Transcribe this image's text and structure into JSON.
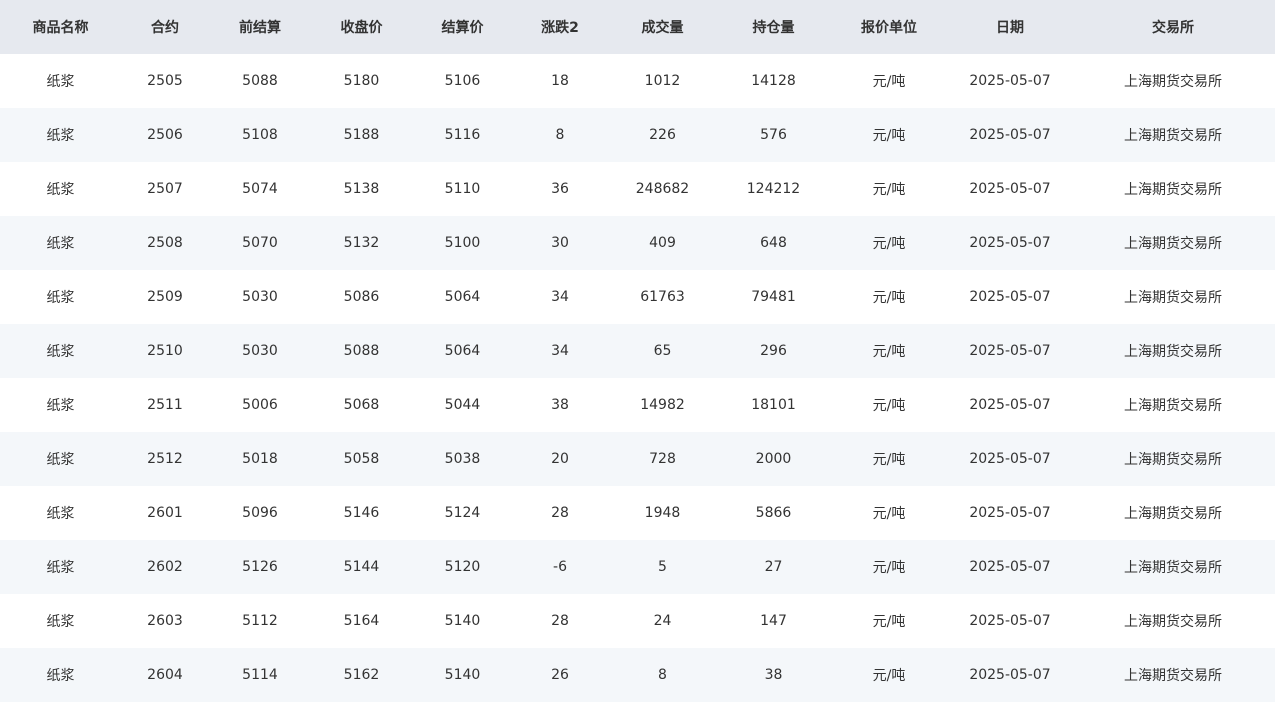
{
  "colors": {
    "up": "#e84c3d",
    "down": "#16a085",
    "header_bg": "#e6e9ef",
    "row_alt_bg": "#f4f7fa"
  },
  "table": {
    "columns": [
      "商品名称",
      "合约",
      "前结算",
      "收盘价",
      "结算价",
      "涨跌2",
      "成交量",
      "持仓量",
      "报价单位",
      "日期",
      "交易所"
    ],
    "rows": [
      {
        "name": "纸浆",
        "contract": "2505",
        "prev_settle": "5088",
        "close": "5180",
        "settle": "5106",
        "change": "18",
        "direction": "up",
        "volume": "1012",
        "open_interest": "14128",
        "unit": "元/吨",
        "date": "2025-05-07",
        "exchange": "上海期货交易所"
      },
      {
        "name": "纸浆",
        "contract": "2506",
        "prev_settle": "5108",
        "close": "5188",
        "settle": "5116",
        "change": "8",
        "direction": "up",
        "volume": "226",
        "open_interest": "576",
        "unit": "元/吨",
        "date": "2025-05-07",
        "exchange": "上海期货交易所"
      },
      {
        "name": "纸浆",
        "contract": "2507",
        "prev_settle": "5074",
        "close": "5138",
        "settle": "5110",
        "change": "36",
        "direction": "up",
        "volume": "248682",
        "open_interest": "124212",
        "unit": "元/吨",
        "date": "2025-05-07",
        "exchange": "上海期货交易所"
      },
      {
        "name": "纸浆",
        "contract": "2508",
        "prev_settle": "5070",
        "close": "5132",
        "settle": "5100",
        "change": "30",
        "direction": "up",
        "volume": "409",
        "open_interest": "648",
        "unit": "元/吨",
        "date": "2025-05-07",
        "exchange": "上海期货交易所"
      },
      {
        "name": "纸浆",
        "contract": "2509",
        "prev_settle": "5030",
        "close": "5086",
        "settle": "5064",
        "change": "34",
        "direction": "up",
        "volume": "61763",
        "open_interest": "79481",
        "unit": "元/吨",
        "date": "2025-05-07",
        "exchange": "上海期货交易所"
      },
      {
        "name": "纸浆",
        "contract": "2510",
        "prev_settle": "5030",
        "close": "5088",
        "settle": "5064",
        "change": "34",
        "direction": "up",
        "volume": "65",
        "open_interest": "296",
        "unit": "元/吨",
        "date": "2025-05-07",
        "exchange": "上海期货交易所"
      },
      {
        "name": "纸浆",
        "contract": "2511",
        "prev_settle": "5006",
        "close": "5068",
        "settle": "5044",
        "change": "38",
        "direction": "up",
        "volume": "14982",
        "open_interest": "18101",
        "unit": "元/吨",
        "date": "2025-05-07",
        "exchange": "上海期货交易所"
      },
      {
        "name": "纸浆",
        "contract": "2512",
        "prev_settle": "5018",
        "close": "5058",
        "settle": "5038",
        "change": "20",
        "direction": "up",
        "volume": "728",
        "open_interest": "2000",
        "unit": "元/吨",
        "date": "2025-05-07",
        "exchange": "上海期货交易所"
      },
      {
        "name": "纸浆",
        "contract": "2601",
        "prev_settle": "5096",
        "close": "5146",
        "settle": "5124",
        "change": "28",
        "direction": "up",
        "volume": "1948",
        "open_interest": "5866",
        "unit": "元/吨",
        "date": "2025-05-07",
        "exchange": "上海期货交易所"
      },
      {
        "name": "纸浆",
        "contract": "2602",
        "prev_settle": "5126",
        "close": "5144",
        "settle": "5120",
        "change": "-6",
        "direction": "down",
        "volume": "5",
        "open_interest": "27",
        "unit": "元/吨",
        "date": "2025-05-07",
        "exchange": "上海期货交易所"
      },
      {
        "name": "纸浆",
        "contract": "2603",
        "prev_settle": "5112",
        "close": "5164",
        "settle": "5140",
        "change": "28",
        "direction": "up",
        "volume": "24",
        "open_interest": "147",
        "unit": "元/吨",
        "date": "2025-05-07",
        "exchange": "上海期货交易所"
      },
      {
        "name": "纸浆",
        "contract": "2604",
        "prev_settle": "5114",
        "close": "5162",
        "settle": "5140",
        "change": "26",
        "direction": "up",
        "volume": "8",
        "open_interest": "38",
        "unit": "元/吨",
        "date": "2025-05-07",
        "exchange": "上海期货交易所"
      }
    ]
  }
}
